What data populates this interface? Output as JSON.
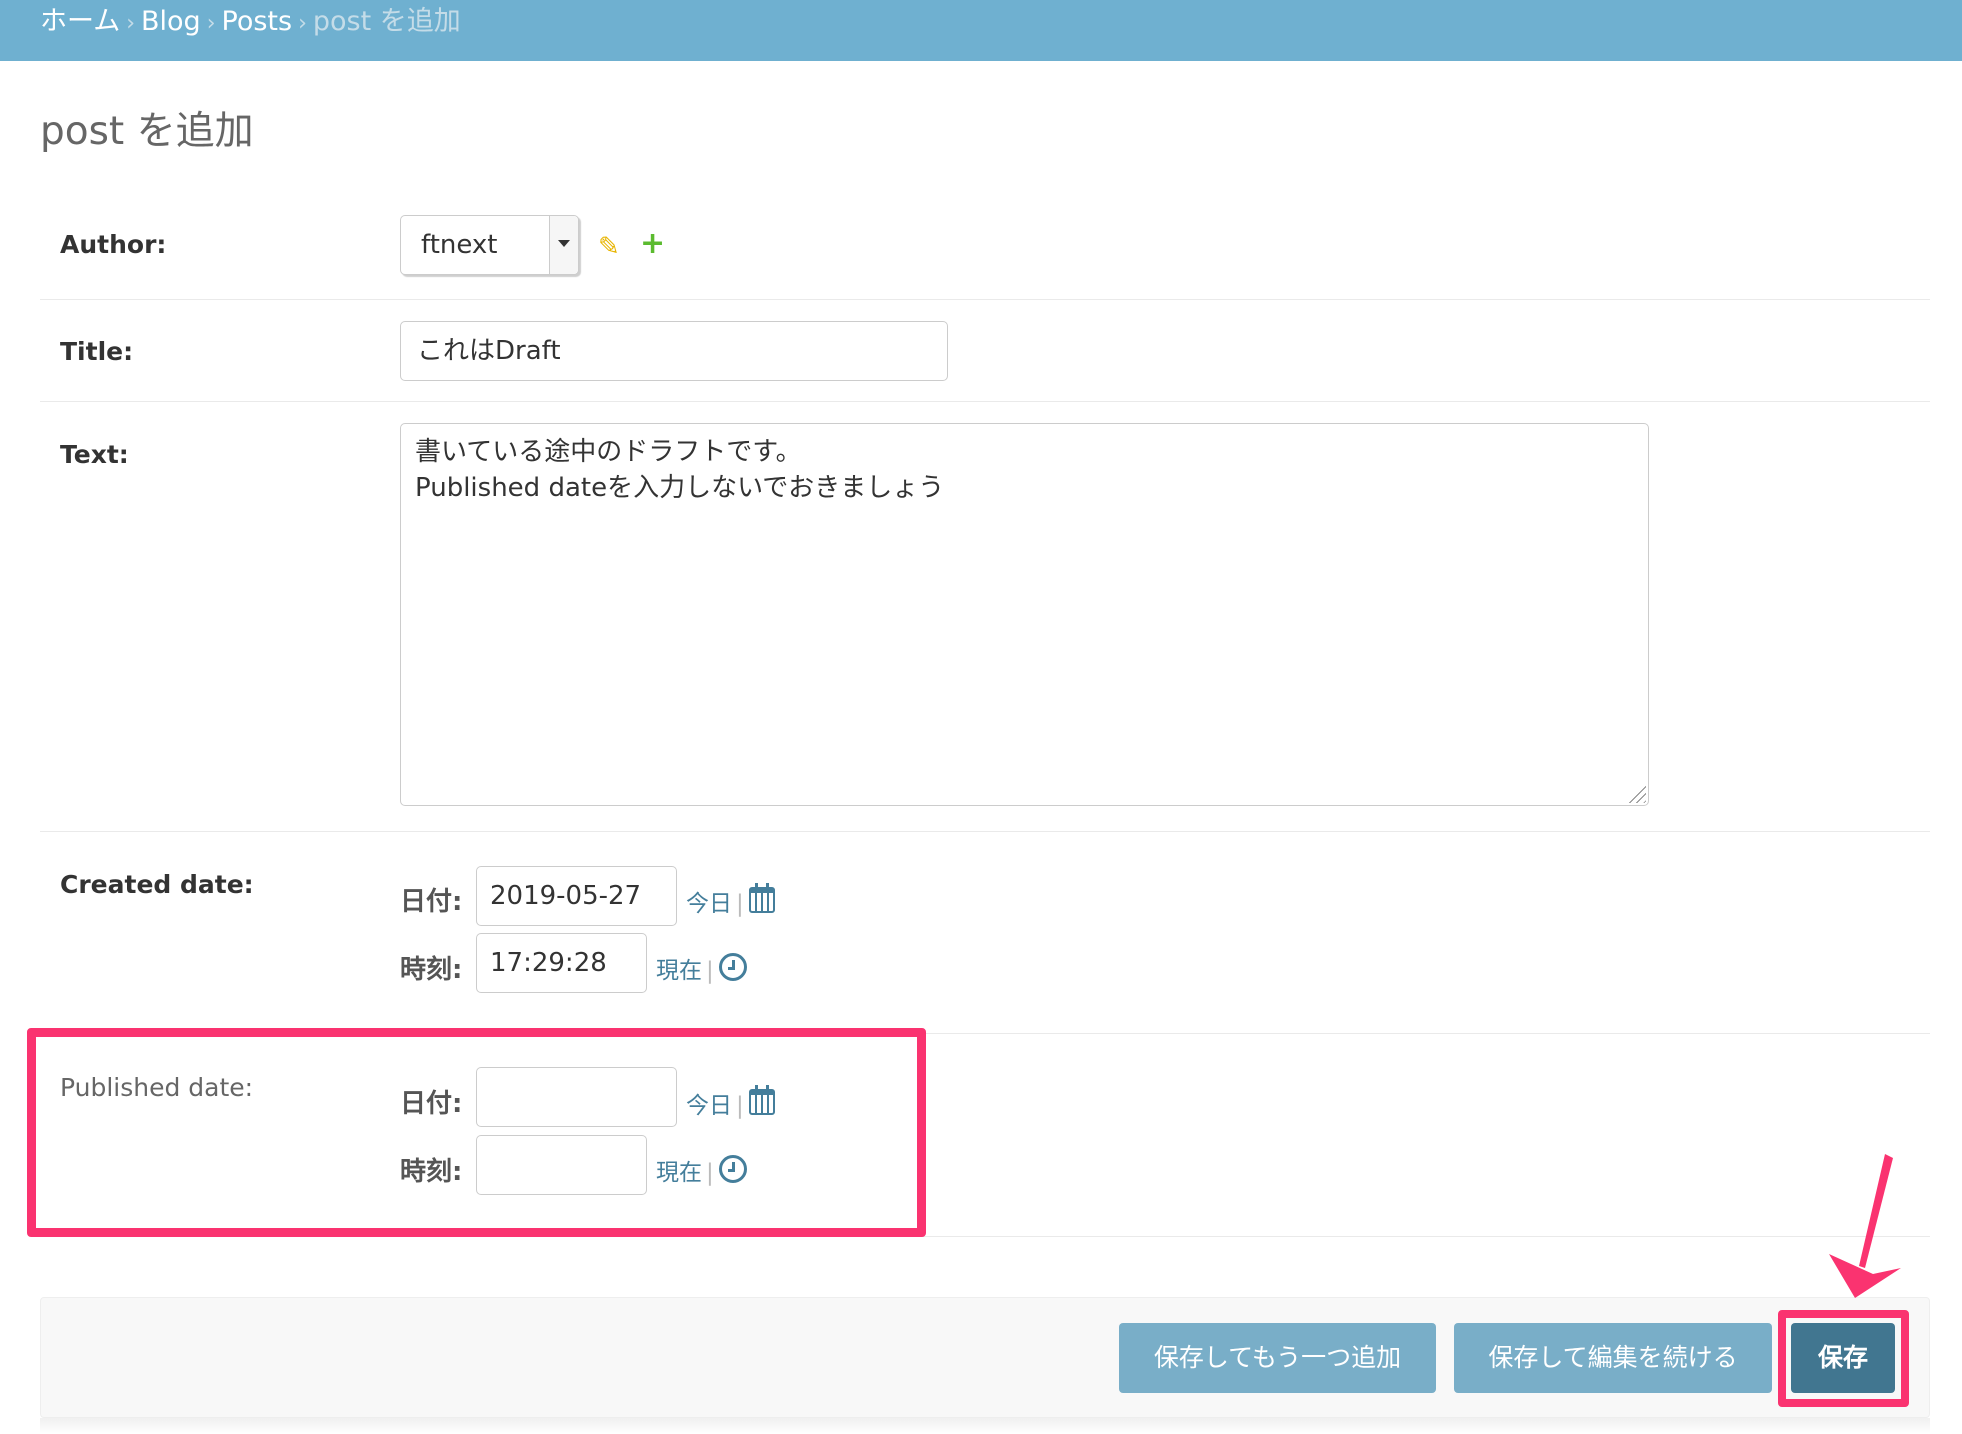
{
  "breadcrumbs": {
    "home": "ホーム",
    "app": "Blog",
    "model": "Posts",
    "current": "post を追加",
    "separator": "›"
  },
  "page": {
    "title": "post を追加"
  },
  "fields": {
    "author": {
      "label": "Author:",
      "value": "ftnext",
      "edit_icon": "pencil-icon",
      "add_icon": "plus-icon",
      "add_glyph": "+"
    },
    "title": {
      "label": "Title:",
      "value": "これはDraft"
    },
    "text": {
      "label": "Text:",
      "lines": [
        "書いている途中のドラフトです。",
        "Published dateを入力しないでおきましょう"
      ]
    },
    "created_date": {
      "label": "Created date:",
      "date_label": "日付:",
      "date_value": "2019-05-27",
      "time_label": "時刻:",
      "time_value": "17:29:28",
      "today_link": "今日",
      "now_link": "現在",
      "pipe": "|"
    },
    "published_date": {
      "label": "Published date:",
      "date_label": "日付:",
      "date_value": "",
      "time_label": "時刻:",
      "time_value": "",
      "today_link": "今日",
      "now_link": "現在",
      "pipe": "|"
    }
  },
  "buttons": {
    "save_add_another": "保存してもう一つ追加",
    "save_continue": "保存して編集を続ける",
    "save": "保存"
  },
  "colors": {
    "header_bg": "#6fb0d0",
    "button_bg": "#79aec8",
    "save_button_bg": "#417690",
    "link": "#447e9b",
    "annotation": "#fa3370"
  }
}
